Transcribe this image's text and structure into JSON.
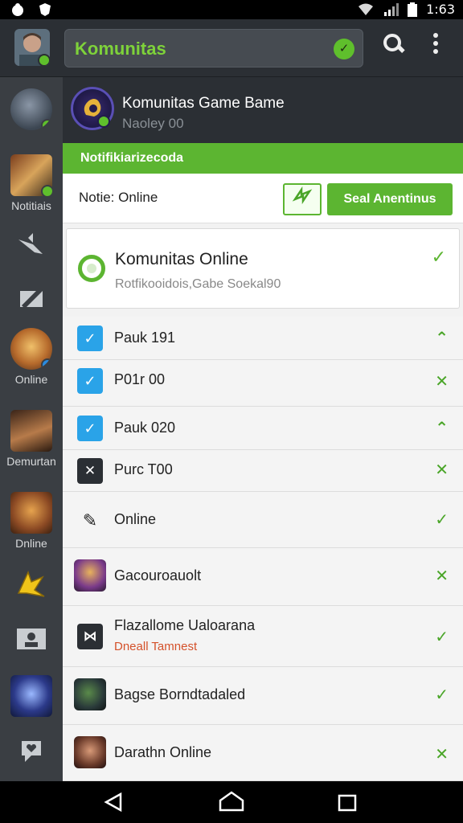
{
  "status": {
    "time": "1:63"
  },
  "appbar": {
    "title": "Komunitas"
  },
  "sidebar": {
    "labels": [
      "Notitiais",
      "Online",
      "Demurtan",
      "Dnline"
    ]
  },
  "header": {
    "title": "Komunitas Game Bame",
    "subtitle": "Naoley 00"
  },
  "notif": {
    "bar_title": "Notifikiarizecoda",
    "row_label": "Notie: Online",
    "button_label": "Seal Anentinus"
  },
  "card": {
    "title": "Komunitas Online",
    "subtitle": "Rotfikooidois,Gabe Soekal90"
  },
  "list": [
    {
      "title": "Pauk 191"
    },
    {
      "title": "P01r 00"
    },
    {
      "title": "Pauk 020"
    },
    {
      "title": "Purc T00"
    },
    {
      "title": "Online"
    },
    {
      "title": "Gacouroauolt"
    },
    {
      "title": "Flazallome Ualoarana",
      "subtitle": "Dneall Tamnest"
    },
    {
      "title": "Bagse Borndtadaled"
    },
    {
      "title": "Darathn Online"
    }
  ],
  "colors": {
    "accent": "#5cb531",
    "appbar": "#2b2f34",
    "sidebar": "#3a3e43"
  }
}
